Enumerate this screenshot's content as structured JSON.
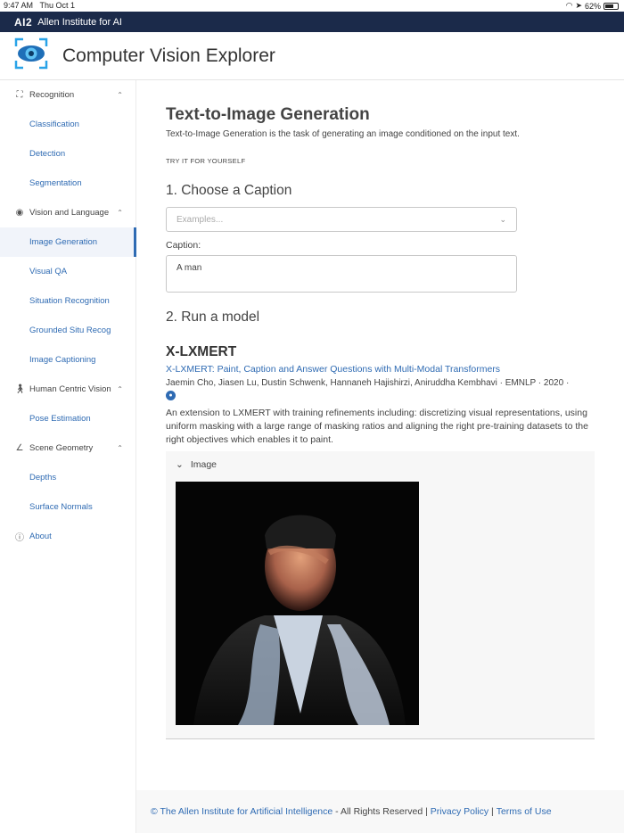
{
  "status": {
    "time": "9:47 AM",
    "date": "Thu Oct 1",
    "battery": "62%"
  },
  "ai2": {
    "logo": "AI2",
    "name": "Allen Institute for AI"
  },
  "app": {
    "title": "Computer Vision Explorer"
  },
  "sidebar": {
    "groups": [
      {
        "label": "Recognition",
        "items": [
          "Classification",
          "Detection",
          "Segmentation"
        ]
      },
      {
        "label": "Vision and Language",
        "items": [
          "Image Generation",
          "Visual QA",
          "Situation Recognition",
          "Grounded Situ Recog",
          "Image Captioning"
        ]
      },
      {
        "label": "Human Centric Vision",
        "items": [
          "Pose Estimation"
        ]
      },
      {
        "label": "Scene Geometry",
        "items": [
          "Depths",
          "Surface Normals"
        ]
      }
    ],
    "about": "About",
    "active_item": "Image Generation"
  },
  "main": {
    "title": "Text-to-Image Generation",
    "description": "Text-to-Image Generation is the task of generating an image conditioned on the input text.",
    "try_label": "TRY IT FOR YOURSELF",
    "step1": "1. Choose a Caption",
    "examples_placeholder": "Examples...",
    "caption_label": "Caption:",
    "caption_value": "A man",
    "step2": "2. Run a model",
    "model_name": "X-LXMERT",
    "paper_title": "X-LXMERT: Paint, Caption and Answer Questions with Multi-Modal Transformers",
    "authors": "Jaemin Cho, Jiasen Lu, Dustin Schwenk, Hannaneh Hajishirzi, Aniruddha Kembhavi · EMNLP · 2020 ·",
    "blurb": "An extension to LXMERT with training refinements including: discretizing visual representations, using uniform masking with a large range of masking ratios and aligning the right pre-training datasets to the right objectives which enables it to paint.",
    "panel_label": "Image"
  },
  "footer": {
    "copyright": "© The Allen Institute for Artificial Intelligence",
    "rights": " - All Rights Reserved | ",
    "privacy": "Privacy Policy",
    "sep": " | ",
    "terms": "Terms of Use"
  }
}
